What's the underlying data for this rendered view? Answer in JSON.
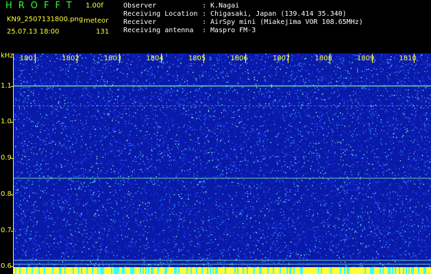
{
  "header": {
    "app_title": "HROFFT",
    "version": "1.00f",
    "filename": "KN9_2507131800.png",
    "mode": "meteor",
    "datetime": "25.07.13 18:00",
    "count": "131",
    "info": [
      {
        "label": "Observer",
        "sep": ":",
        "value": "K.Nagai"
      },
      {
        "label": "Receiving Location",
        "sep": ":",
        "value": "Chigasaki, Japan (139.414 35.340)"
      },
      {
        "label": "Receiver",
        "sep": ":",
        "value": "AirSpy mini (Miakejima VOR 108.65MHz)"
      },
      {
        "label": "Receiving antenna",
        "sep": ":",
        "value": "Maspro FM-3"
      }
    ]
  },
  "chart_data": {
    "type": "heatmap",
    "ylabel": "kHz",
    "y_ticks": [
      "1.1",
      "1.0",
      "0.9",
      "0.8",
      "0.7",
      "0.6"
    ],
    "x_ticks": [
      "1801",
      "1802",
      "1803",
      "1804",
      "1805",
      "1806",
      "1807",
      "1808",
      "1809",
      "1810"
    ],
    "ylim": [
      0.58,
      1.19
    ],
    "xlim": [
      1800.5,
      1810.4
    ],
    "horizontal_lines_khz": [
      1.1,
      1.045,
      0.845,
      0.618,
      0.607
    ],
    "colors": {
      "background": "#0a1aa8",
      "noise_low": "#1e3cff",
      "noise_mid": "#3aa0ff",
      "noise_high": "#8cffc8",
      "line": "#7fffb0",
      "axis": "#ffff33"
    }
  }
}
